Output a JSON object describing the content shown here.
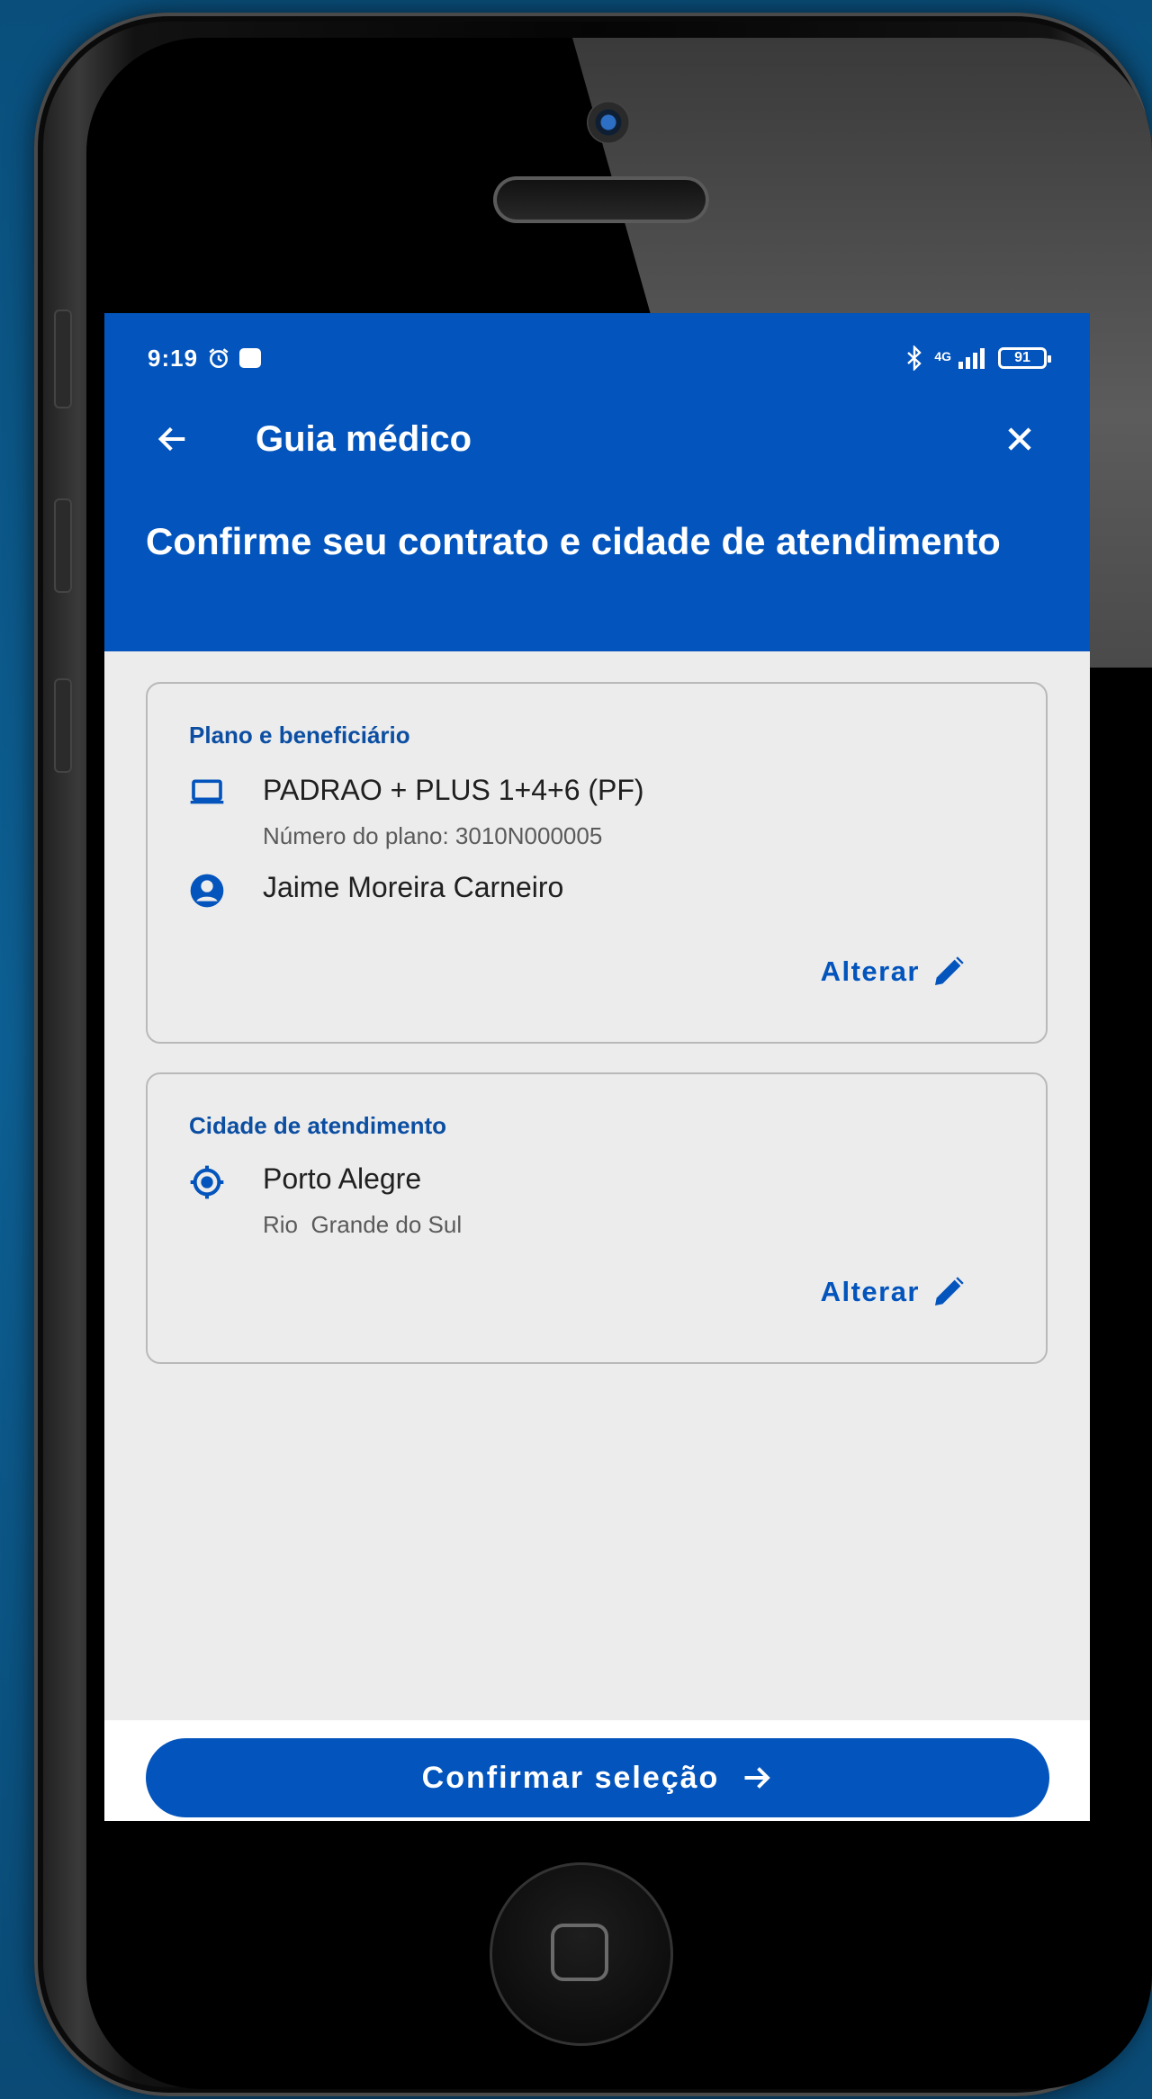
{
  "status_bar": {
    "time": "9:19",
    "network": "4G",
    "battery": "91"
  },
  "appbar": {
    "title": "Guia médico"
  },
  "heading": "Confirme seu contrato e cidade de atendimento",
  "plan_card": {
    "label": "Plano e beneficiário",
    "plan_name": "PADRAO + PLUS 1+4+6 (PF)",
    "plan_number": "Número do plano: 3010N000005",
    "beneficiary": "Jaime Moreira Carneiro",
    "change_label": "Alterar"
  },
  "city_card": {
    "label": "Cidade de atendimento",
    "city": "Porto Alegre",
    "state": "Rio  Grande do Sul",
    "change_label": "Alterar"
  },
  "confirm_button": {
    "label": "Confirmar seleção"
  },
  "colors": {
    "primary": "#0354bc",
    "background": "#ececec"
  }
}
